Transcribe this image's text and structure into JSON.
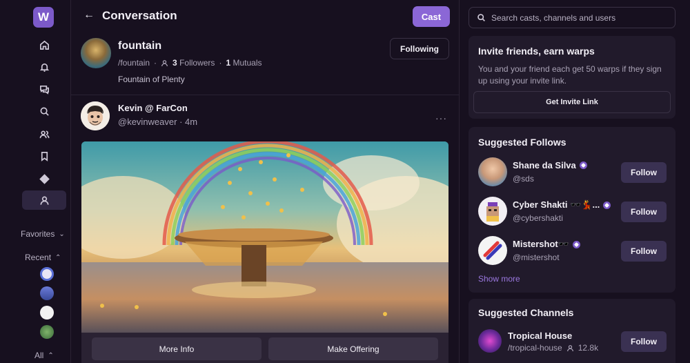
{
  "app": {
    "logo_letter": "W"
  },
  "sidebar": {
    "icons": [
      "home-icon",
      "bell-icon",
      "chat-icon",
      "search-icon",
      "users-icon",
      "bookmark-icon",
      "diamond-icon",
      "profile-icon"
    ],
    "favorites_label": "Favorites",
    "recent_label": "Recent",
    "all_label": "All"
  },
  "header": {
    "back_icon": "arrow-left-icon",
    "title": "Conversation",
    "cast_label": "Cast"
  },
  "channel": {
    "name": "fountain",
    "handle": "/fountain",
    "followers_count": "3",
    "followers_label": "Followers",
    "mutuals_count": "1",
    "mutuals_label": "Mutuals",
    "description": "Fountain of Plenty",
    "following_label": "Following"
  },
  "cast": {
    "author": "Kevin @ FarCon",
    "handle_time": "@kevinweaver · 4m",
    "more_label": "···",
    "frame_buttons": [
      "More Info",
      "Make Offering"
    ]
  },
  "search": {
    "placeholder": "Search casts, channels and users"
  },
  "invite": {
    "title": "Invite friends, earn warps",
    "text": "You and your friend each get 50 warps if they sign up using your invite link.",
    "button": "Get Invite Link"
  },
  "suggested_follows": {
    "title": "Suggested Follows",
    "users": [
      {
        "name": "Shane da Silva",
        "handle": "@sds",
        "follow_label": "Follow"
      },
      {
        "name": "Cyber Shakti 🕶️💃...",
        "handle": "@cybershakti",
        "follow_label": "Follow"
      },
      {
        "name": "Mistershot🕶️",
        "handle": "@mistershot",
        "follow_label": "Follow"
      }
    ],
    "show_more": "Show more"
  },
  "suggested_channels": {
    "title": "Suggested Channels",
    "channels": [
      {
        "name": "Tropical House",
        "handle": "/tropical-house",
        "members": "12.8k",
        "follow_label": "Follow"
      }
    ]
  },
  "colors": {
    "accent": "#8b67d6",
    "background": "#17101f",
    "card": "#211a2b"
  }
}
